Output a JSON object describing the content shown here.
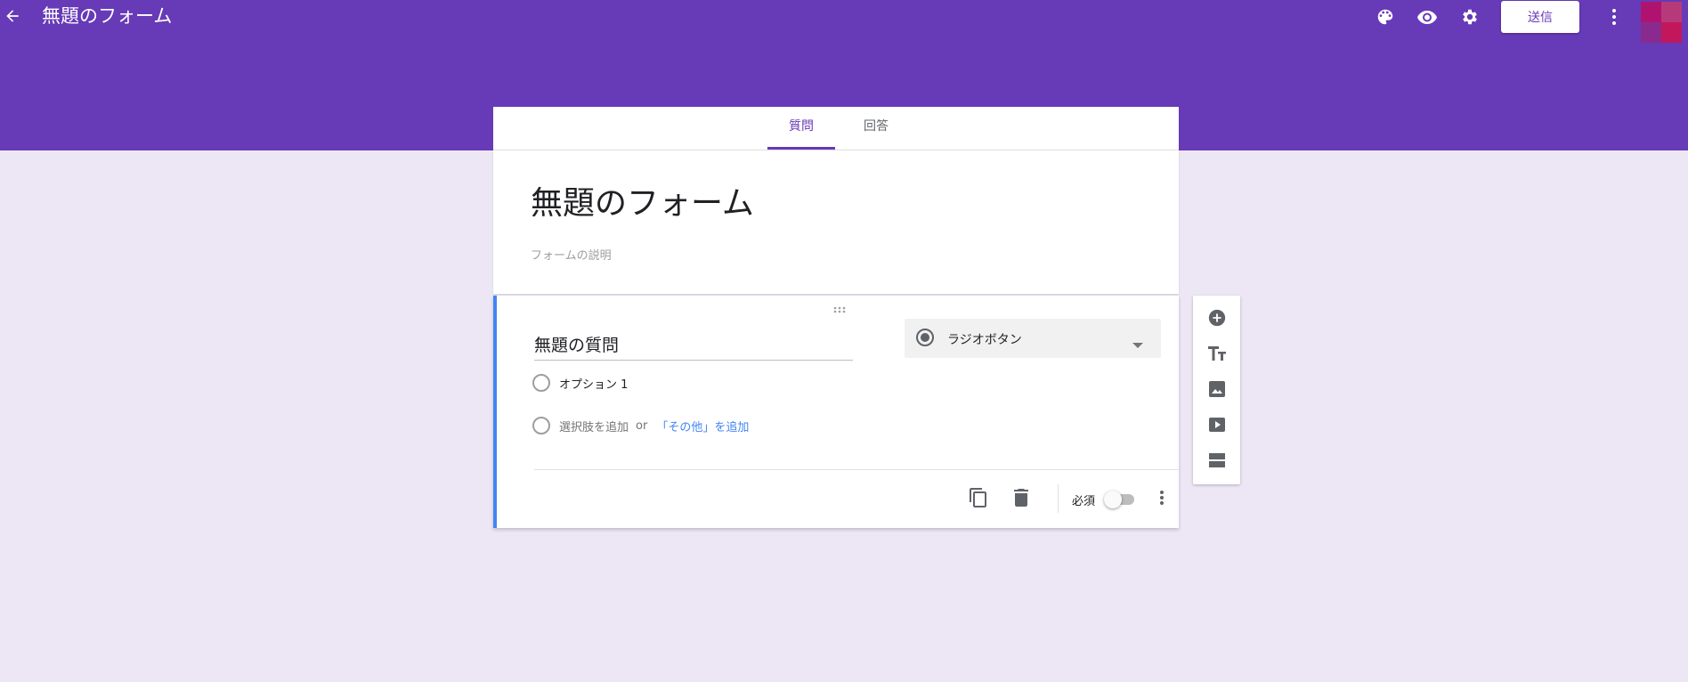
{
  "header": {
    "title": "無題のフォーム",
    "send_label": "送信",
    "icons": [
      "back-arrow-icon",
      "palette-icon",
      "eye-icon",
      "gear-icon",
      "more-vert-icon"
    ],
    "accent": "#673ab7"
  },
  "tabs": [
    {
      "label": "質問",
      "active": true
    },
    {
      "label": "回答",
      "active": false
    }
  ],
  "form": {
    "title": "無題のフォーム",
    "description_placeholder": "フォームの説明"
  },
  "question": {
    "title": "無題の質問",
    "type_label": "ラジオボタン",
    "options": [
      "オプション 1"
    ],
    "add_option": "選択肢を追加",
    "or": "or",
    "add_other": "「その他」を追加",
    "required_label": "必須",
    "required": false
  },
  "side_toolbar": {
    "icons": [
      "add-circle-icon",
      "title-text-icon",
      "image-icon",
      "video-icon",
      "section-icon"
    ]
  },
  "colors": {
    "background": "#ede7f5",
    "link": "#4285f4"
  }
}
